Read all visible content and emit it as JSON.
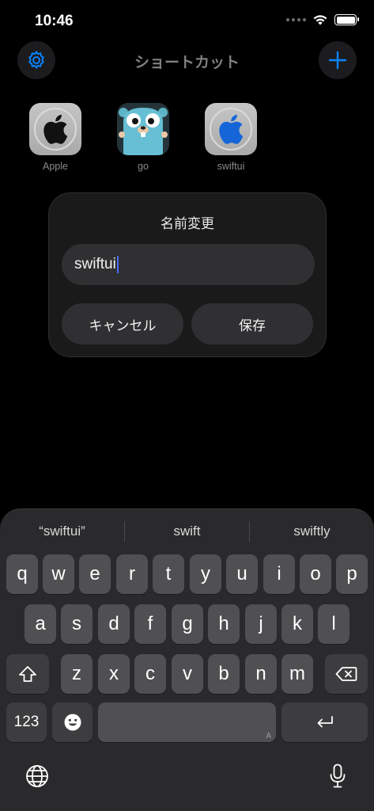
{
  "status": {
    "time": "10:46"
  },
  "nav": {
    "title": "ショートカット",
    "settings_icon": "gear-icon",
    "add_icon": "plus-icon",
    "accent": "#0a84ff"
  },
  "apps": [
    {
      "label": "Apple",
      "icon": "apple-logo-icon"
    },
    {
      "label": "go",
      "icon": "gopher-icon"
    },
    {
      "label": "swiftui",
      "icon": "apple-logo-icon"
    }
  ],
  "dialog": {
    "title": "名前変更",
    "field_value": "swiftui",
    "cancel_label": "キャンセル",
    "save_label": "保存"
  },
  "keyboard": {
    "suggestions": [
      "“swiftui”",
      "swift",
      "swiftly"
    ],
    "row1": [
      "q",
      "w",
      "e",
      "r",
      "t",
      "y",
      "u",
      "i",
      "o",
      "p"
    ],
    "row2": [
      "a",
      "s",
      "d",
      "f",
      "g",
      "h",
      "j",
      "k",
      "l"
    ],
    "row3": [
      "z",
      "x",
      "c",
      "v",
      "b",
      "n",
      "m"
    ],
    "numbers_label": "123",
    "space_hint": "A",
    "icons": {
      "shift": "shift-icon",
      "delete": "delete-icon",
      "emoji": "emoji-icon",
      "return": "return-icon",
      "globe": "globe-icon",
      "mic": "microphone-icon"
    }
  }
}
